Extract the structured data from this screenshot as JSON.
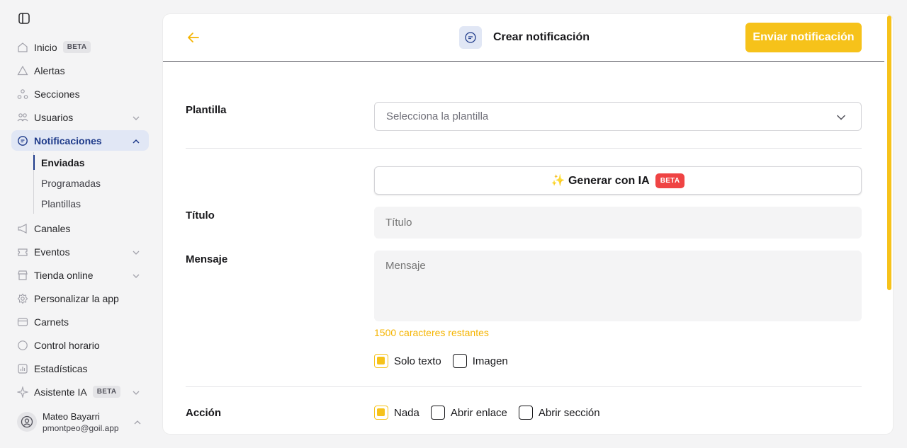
{
  "sidebar": {
    "items": [
      {
        "label": "Inicio",
        "badge": "BETA",
        "icon": "home-icon"
      },
      {
        "label": "Alertas",
        "icon": "alert-icon"
      },
      {
        "label": "Secciones",
        "icon": "sections-icon"
      },
      {
        "label": "Usuarios",
        "icon": "users-icon"
      },
      {
        "label": "Notificaciones",
        "icon": "chat-icon"
      },
      {
        "label": "Canales",
        "icon": "megaphone-icon"
      },
      {
        "label": "Eventos",
        "icon": "ticket-icon"
      },
      {
        "label": "Tienda online",
        "icon": "store-icon"
      },
      {
        "label": "Personalizar la app",
        "icon": "gear-icon"
      },
      {
        "label": "Carnets",
        "icon": "card-icon"
      },
      {
        "label": "Control horario",
        "icon": "clock-icon"
      },
      {
        "label": "Estadísticas",
        "icon": "chart-icon"
      },
      {
        "label": "Asistente IA",
        "badge": "BETA",
        "icon": "sparkle-icon"
      }
    ],
    "sub_items": [
      "Enviadas",
      "Programadas",
      "Plantillas"
    ],
    "user": {
      "name": "Mateo Bayarri",
      "email": "pmontpeo@goil.app"
    }
  },
  "header": {
    "title": "Crear notificación",
    "send_label": "Enviar notificación"
  },
  "form": {
    "template_label": "Plantilla",
    "template_placeholder": "Selecciona la plantilla",
    "ai_button_label": "✨ Generar con IA",
    "ai_badge": "BETA",
    "title_label": "Título",
    "title_placeholder": "Título",
    "message_label": "Mensaje",
    "message_placeholder": "Mensaje",
    "char_counter": "1500 caracteres restantes",
    "content_options": [
      {
        "label": "Solo texto",
        "checked": true
      },
      {
        "label": "Imagen",
        "checked": false
      }
    ],
    "action_label": "Acción",
    "action_options": [
      {
        "label": "Nada",
        "checked": true
      },
      {
        "label": "Abrir enlace",
        "checked": false
      },
      {
        "label": "Abrir sección",
        "checked": false
      }
    ]
  },
  "colors": {
    "accent": "#f6c21a",
    "nav_active_bg": "#e1e7f5",
    "nav_active_text": "#1e3a8a",
    "beta_red": "#ef4444"
  }
}
